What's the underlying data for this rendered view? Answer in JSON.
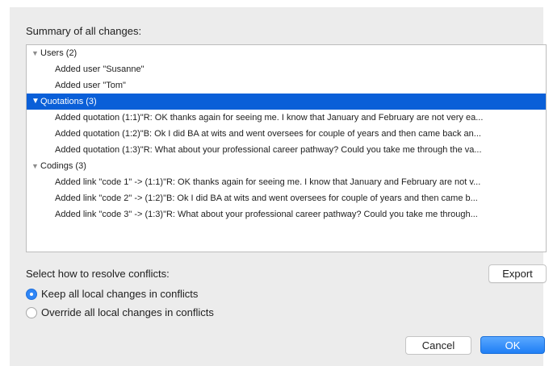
{
  "summary": {
    "label": "Summary of all changes:",
    "groups": [
      {
        "label": "Users (2)",
        "selected": false,
        "items": [
          "Added user \"Susanne\"",
          "Added user \"Tom\""
        ]
      },
      {
        "label": "Quotations (3)",
        "selected": true,
        "items": [
          "Added quotation (1:1)\"R: OK thanks again for seeing me. I know that January and February are not very ea...",
          "Added quotation (1:2)\"B: Ok I did BA at wits and went oversees for couple of years and then came back an...",
          "Added quotation (1:3)\"R: What about your professional career pathway? Could you take me through the va..."
        ]
      },
      {
        "label": "Codings (3)",
        "selected": false,
        "items": [
          "Added link \"code 1\" -> (1:1)\"R: OK thanks again for seeing me. I know that January and February are not v...",
          "Added link \"code 2\" -> (1:2)\"B: Ok I did BA at wits and went oversees for couple of years and then came b...",
          "Added link \"code 3\" -> (1:3)\"R: What about your professional career pathway? Could you take me through..."
        ]
      }
    ]
  },
  "conflicts": {
    "label": "Select how to resolve conflicts:",
    "options": [
      {
        "label": "Keep all local changes in conflicts",
        "selected": true
      },
      {
        "label": "Override all local changes in conflicts",
        "selected": false
      }
    ]
  },
  "buttons": {
    "export": "Export",
    "cancel": "Cancel",
    "ok": "OK"
  },
  "colors": {
    "selection": "#0a5fd8",
    "accent": "#2f86f6"
  }
}
